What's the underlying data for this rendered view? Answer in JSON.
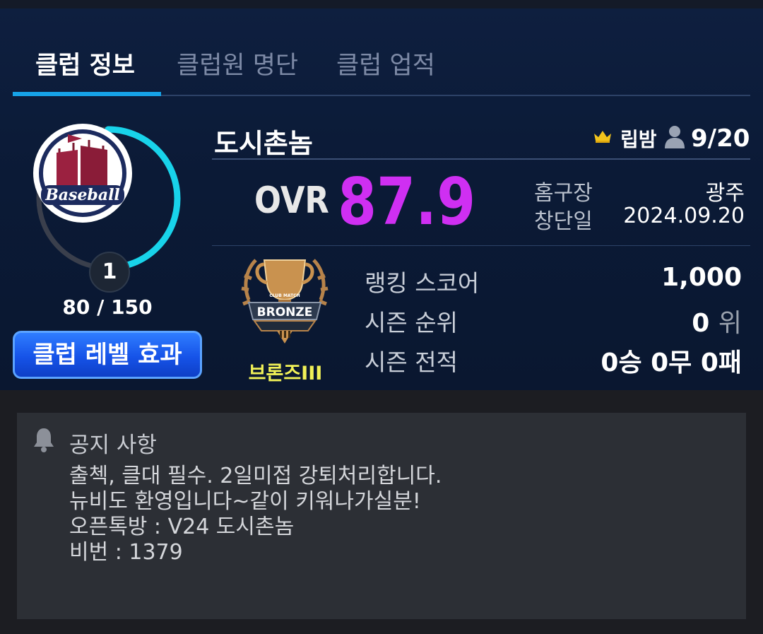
{
  "tabs": [
    {
      "label": "클럽 정보",
      "active": true
    },
    {
      "label": "클럽원 명단",
      "active": false
    },
    {
      "label": "클럽 업적",
      "active": false
    }
  ],
  "club": {
    "name": "도시촌놈",
    "leader": "립밤",
    "members": "9/20",
    "logo_text": "Baseball",
    "level": "1",
    "exp": "80 / 150",
    "exp_progress": 0.533,
    "level_effect_button": "클럽 레벨 효과"
  },
  "ovr": {
    "label": "OVR",
    "value": "87.9"
  },
  "info": [
    {
      "label": "홈구장",
      "value": "광주"
    },
    {
      "label": "창단일",
      "value": "2024.09.20"
    }
  ],
  "tier": {
    "name": "브론즈III",
    "emblem_text": "BRONZE",
    "emblem_subtext": "CLUB MATCH"
  },
  "stats": {
    "ranking_score": {
      "label": "랭킹 스코어",
      "value": "1,000"
    },
    "season_rank": {
      "label": "시즌 순위",
      "value": "0",
      "unit": "위"
    },
    "season_record": {
      "label": "시즌 전적",
      "value": "0승 0무 0패"
    }
  },
  "notice": {
    "title": "공지 사항",
    "lines": [
      "출첵, 클대 필수. 2일미접 강퇴처리합니다.",
      "뉴비도 환영입니다~같이 키워나가실분!",
      "오픈톡방 : V24 도시촌놈",
      "비번 : 1379"
    ]
  },
  "colors": {
    "accent_tab": "#16a3e8",
    "ovr": "#cf2ff2",
    "tier": "#f1f157",
    "exp_ring": "#18d3ea",
    "button": "#1653e8"
  },
  "icons": [
    "crown-icon",
    "person-icon",
    "bell-icon",
    "club-logo",
    "bronze-trophy-emblem"
  ]
}
